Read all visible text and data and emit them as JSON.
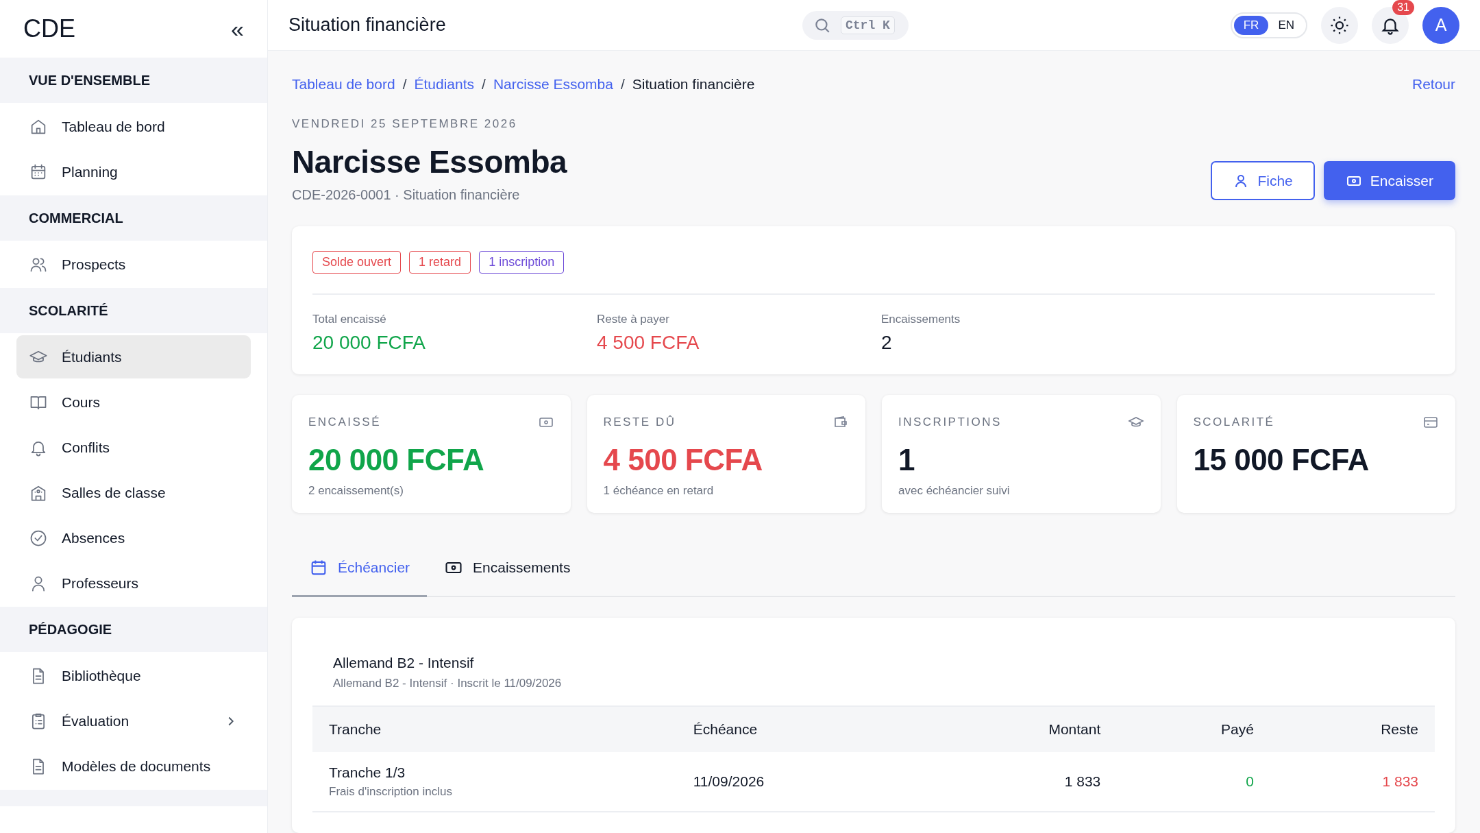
{
  "sidebar": {
    "logo": "CDE",
    "collapse": "«",
    "sections": [
      {
        "title": "VUE D'ENSEMBLE",
        "items": [
          {
            "label": "Tableau de bord",
            "kind": "link",
            "selected": false
          },
          {
            "label": "Planning",
            "kind": "link",
            "selected": false
          }
        ]
      },
      {
        "title": "COMMERCIAL",
        "items": [
          {
            "label": "Prospects",
            "kind": "link",
            "selected": false
          }
        ]
      },
      {
        "title": "SCOLARITÉ",
        "items": [
          {
            "label": "Étudiants",
            "kind": "link",
            "selected": true
          },
          {
            "label": "Cours",
            "kind": "link",
            "selected": false
          },
          {
            "label": "Conflits",
            "kind": "link",
            "selected": false
          },
          {
            "label": "Salles de classe",
            "kind": "link",
            "selected": false
          },
          {
            "label": "Absences",
            "kind": "link",
            "selected": false
          },
          {
            "label": "Professeurs",
            "kind": "link",
            "selected": false
          }
        ]
      },
      {
        "title": "PÉDAGOGIE",
        "items": [
          {
            "label": "Bibliothèque",
            "kind": "link",
            "selected": false
          },
          {
            "label": "Évaluation",
            "kind": "group",
            "selected": false
          },
          {
            "label": "Modèles de documents",
            "kind": "link",
            "selected": false
          }
        ]
      }
    ]
  },
  "topbar": {
    "title": "Situation financière",
    "search_shortcut": "Ctrl K",
    "languages": [
      {
        "label": "FR",
        "selected": true
      },
      {
        "label": "EN",
        "selected": false
      }
    ],
    "notifications": "31",
    "avatar": "A"
  },
  "breadcrumb": [
    "Tableau de bord",
    "Étudiants",
    "Narcisse Essomba",
    "Situation financière"
  ],
  "breadcrumb_separators": [
    "/",
    "/",
    "/"
  ],
  "back_link": "Retour",
  "date": "VENDREDI 25 SEPTEMBRE 2026",
  "student": {
    "name": "Narcisse Essomba",
    "subtitle": "CDE-2026-0001 · Situation financière"
  },
  "actions": [
    {
      "label": "Fiche",
      "kind": "secondary"
    },
    {
      "label": "Encaisser",
      "kind": "primary"
    }
  ],
  "summary": {
    "chips": [
      {
        "label": "Solde ouvert",
        "color": "#e5484d"
      },
      {
        "label": "1 retard",
        "color": "#e5484d"
      },
      {
        "label": "1 inscription",
        "color": "#6d4bd8"
      }
    ],
    "metrics": [
      {
        "label": "Total encaissé",
        "value": "20 000 FCFA",
        "color": "#10a54a"
      },
      {
        "label": "Reste à payer",
        "value": "4 500 FCFA",
        "color": "#e5484d"
      },
      {
        "label": "Encaissements",
        "value": "2",
        "color": "#111827"
      }
    ]
  },
  "stats": [
    {
      "label": "ENCAISSÉ",
      "value": "20 000 FCFA",
      "note": "2 encaissement(s)",
      "color": "#10a54a"
    },
    {
      "label": "RESTE DÛ",
      "value": "4 500 FCFA",
      "note": "1 échéance en retard",
      "color": "#e5484d"
    },
    {
      "label": "INSCRIPTIONS",
      "value": "1",
      "note": "avec échéancier suivi",
      "color": "#111827"
    },
    {
      "label": "SCOLARITÉ",
      "value": "15 000 FCFA",
      "color": "#111827"
    }
  ],
  "tabs": [
    {
      "label": "Échéancier",
      "selected": true
    },
    {
      "label": "Encaissements",
      "selected": false
    }
  ],
  "schedule": {
    "course": "Allemand B2 - Intensif",
    "course_note": "Allemand B2 - Intensif · Inscrit le 11/09/2026",
    "columns": [
      "Tranche",
      "Échéance",
      "Montant",
      "Payé",
      "Reste"
    ],
    "rows": [
      {
        "tranche": "Tranche 1/3",
        "note": "Frais d'inscription inclus",
        "due": "11/09/2026",
        "amount": "1 833",
        "paid": "0",
        "remaining": "1 833"
      }
    ]
  }
}
